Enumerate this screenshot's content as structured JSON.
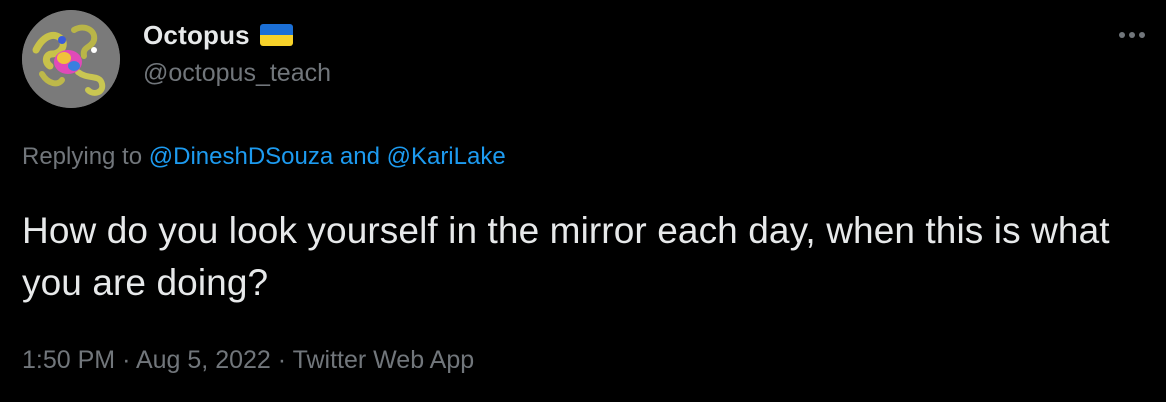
{
  "author": {
    "display_name": "Octopus",
    "handle": "@octopus_teach",
    "badge_icon": "ukraine-flag-icon",
    "flag_colors": [
      "#1b6fd6",
      "#f7d22a"
    ]
  },
  "more_icon": "more-options-icon",
  "reply": {
    "prefix": "Replying to",
    "mention_1": "@DineshDSouza",
    "joiner": "and",
    "mention_2": "@KariLake"
  },
  "tweet": {
    "text": "How do you look yourself in the mirror each day, when this is what you are doing?"
  },
  "meta": {
    "time": "1:50 PM",
    "separator_1": "·",
    "date": "Aug 5, 2022",
    "separator_2": "·",
    "source": "Twitter Web App"
  },
  "colors": {
    "background": "#000000",
    "primary_text": "#e7e9ea",
    "secondary_text": "#71767b",
    "link": "#1d9bf0"
  }
}
